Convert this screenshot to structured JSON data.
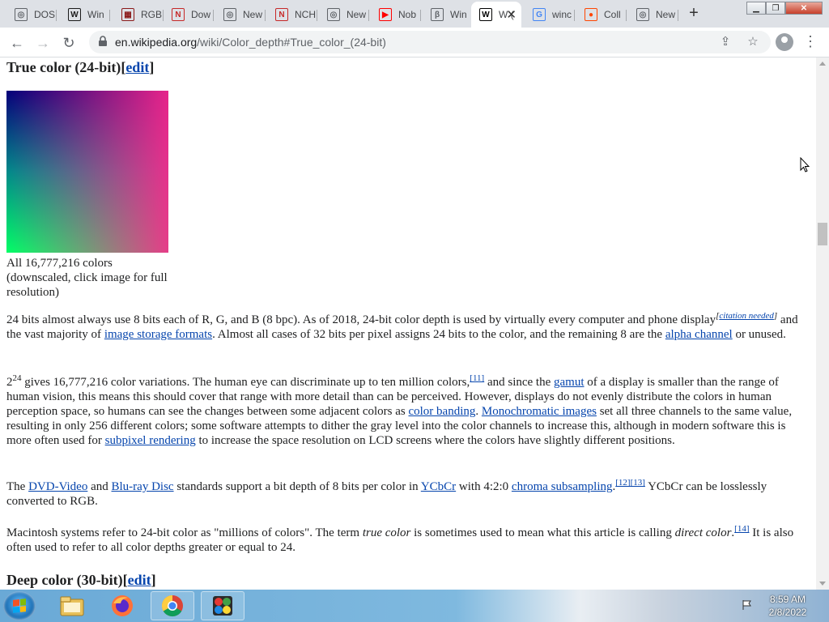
{
  "browser": {
    "tabs": [
      {
        "label": "DOS",
        "icon": "chrome-icon",
        "color": "#5f6368"
      },
      {
        "label": "Win",
        "icon": "winamp-icon",
        "color": "#1b1b1b"
      },
      {
        "label": "RGB",
        "icon": "rgb-icon",
        "color": "#8b1a1a"
      },
      {
        "label": "Dow",
        "icon": "nch-icon",
        "color": "#c62828"
      },
      {
        "label": "New",
        "icon": "chrome-icon",
        "color": "#5f6368"
      },
      {
        "label": "NCH",
        "icon": "nch-icon",
        "color": "#c62828"
      },
      {
        "label": "New",
        "icon": "chrome-icon",
        "color": "#5f6368"
      },
      {
        "label": "Nob",
        "icon": "youtube-icon",
        "color": "#ff0000"
      },
      {
        "label": "Win",
        "icon": "beta-icon",
        "color": "#5f6368"
      },
      {
        "label": "W (",
        "icon": "wikipedia-icon",
        "color": "#000000"
      },
      {
        "label": "winc",
        "icon": "google-icon",
        "color": "#4285f4"
      },
      {
        "label": "Coll",
        "icon": "reddit-icon",
        "color": "#ff4500"
      },
      {
        "label": "New",
        "icon": "chrome-icon",
        "color": "#5f6368"
      }
    ],
    "active_tab_index": 9,
    "url_domain": "en.wikipedia.org",
    "url_path": "/wiki/Color_depth#True_color_(24-bit)"
  },
  "article": {
    "heading1": "True color (24-bit)",
    "edit_label": "edit",
    "caption": "All 16,777,216 colors (downscaled, click image for full resolution)",
    "p1": {
      "t1": "24 bits almost always use 8 bits each of R, G, and B (8 bpc). As of 2018, 24-bit color depth is used by virtually every computer and phone display",
      "cn": "citation needed",
      "t2": " and the vast majority of ",
      "l1": "image storage formats",
      "t3": ". Almost all cases of 32 bits per pixel assigns 24 bits to the color, and the remaining 8 are the ",
      "l2": "alpha channel",
      "t4": " or unused."
    },
    "p2": {
      "t1": "2",
      "exp": "24",
      "t2": " gives 16,777,216 color variations. The human eye can discriminate up to ten million colors,",
      "r1": "[11]",
      "t3": " and since the ",
      "l1": "gamut",
      "t4": " of a display is smaller than the range of human vision, this means this should cover that range with more detail than can be perceived. However, displays do not evenly distribute the colors in human perception space, so humans can see the changes between some adjacent colors as ",
      "l2": "color banding",
      "t5": ". ",
      "l3": "Monochromatic images",
      "t6": " set all three channels to the same value, resulting in only 256 different colors; some software attempts to dither the gray level into the color channels to increase this, although in modern software this is more often used for ",
      "l4": "subpixel rendering",
      "t7": " to increase the space resolution on LCD screens where the colors have slightly different positions."
    },
    "p3": {
      "t1": "The ",
      "l1": "DVD-Video",
      "t2": " and ",
      "l2": "Blu-ray Disc",
      "t3": " standards support a bit depth of 8 bits per color in ",
      "l3": "YCbCr",
      "t4": " with 4:2:0 ",
      "l4": "chroma subsampling",
      "t5": ".",
      "r1": "[12]",
      "r2": "[13]",
      "t6": " YCbCr can be losslessly converted to RGB."
    },
    "p4": {
      "t1": "Macintosh systems refer to 24-bit color as \"millions of colors\". The term ",
      "i1": "true color",
      "t2": " is sometimes used to mean what this article is calling ",
      "i2": "direct color",
      "t3": ".",
      "r1": "[14]",
      "t4": " It is also often used to refer to all color depths greater or equal to 24."
    },
    "heading2": "Deep color (30-bit)"
  },
  "taskbar": {
    "time": "8:59 AM",
    "date": "2/8/2022"
  }
}
